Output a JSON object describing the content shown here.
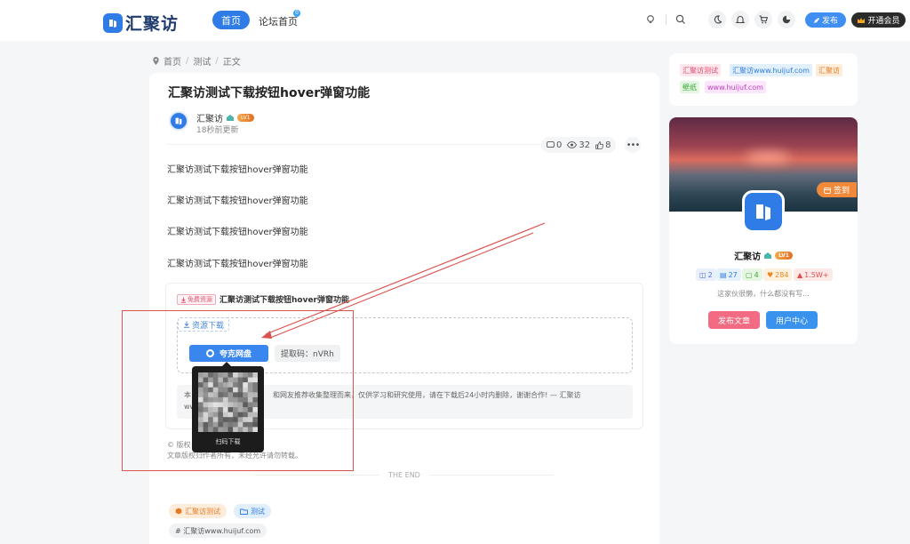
{
  "header": {
    "logo_text": "汇聚访",
    "nav_home": "首页",
    "nav_forum": "论坛首页",
    "nav_forum_badge": "0",
    "publish": "发布",
    "vip": "开通会员"
  },
  "breadcrumb": [
    "首页",
    "测试",
    "正文"
  ],
  "article": {
    "title": "汇聚访测试下载按钮hover弹窗功能",
    "author": "汇聚访",
    "level": "LV1",
    "updated": "18秒前更新",
    "stats": {
      "comments": "0",
      "views": "32",
      "likes": "8"
    },
    "paragraphs": [
      "汇聚访测试下载按钮hover弹窗功能",
      "汇聚访测试下载按钮hover弹窗功能",
      "汇聚访测试下载按钮hover弹窗功能",
      "汇聚访测试下载按钮hover弹窗功能"
    ]
  },
  "download": {
    "tag": "免费资源",
    "title": "汇聚访测试下载按钮hover弹窗功能",
    "section_label": "资源下载",
    "button": "夸克网盘",
    "code": "提取码：nVRh",
    "notice_a": "本",
    "notice_b": "和网友推荐收集整理而来，仅供学习和研究使用，请在下载后24小时内删除，谢谢合作! — 汇聚访",
    "notice_c": "ww",
    "qr_caption": "扫码下载"
  },
  "copyright": {
    "line1": "© 版权",
    "line2": "文章版权归作者所有，未经允许请勿转载。"
  },
  "the_end": "THE END",
  "tags": {
    "category": "汇聚访测试",
    "folder": "测试",
    "hashtag": "# 汇聚访www.huijuf.com"
  },
  "sidebar": {
    "tags": [
      "汇聚访测试",
      "汇聚访www.huijuf.com",
      "汇聚访",
      "壁纸",
      "www.huijuf.com"
    ],
    "signin": "签到",
    "name": "汇聚访",
    "level": "LV1",
    "stats": [
      "2",
      "27",
      "4",
      "284",
      "1.5W+"
    ],
    "bio": "这家伙很懒，什么都没有写...",
    "btn_publish": "发布文章",
    "btn_center": "用户中心"
  },
  "colors": {
    "accent": "#2f7ce6",
    "annotation": "#d9534f"
  }
}
